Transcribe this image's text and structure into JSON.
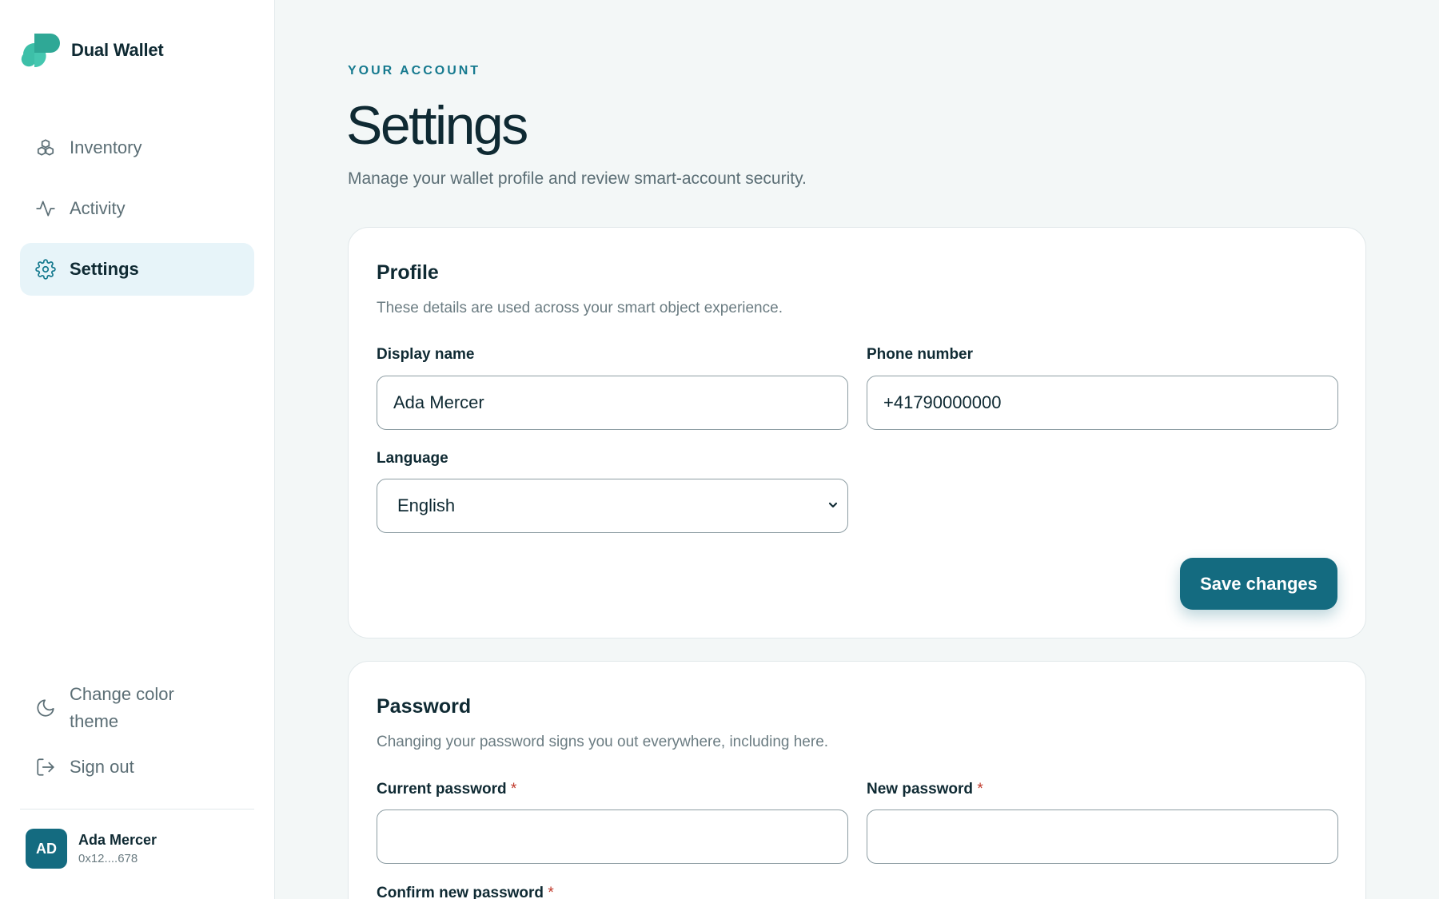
{
  "app": {
    "name": "Dual Wallet"
  },
  "sidebar": {
    "nav": [
      {
        "label": "Inventory",
        "icon": "boxes-icon"
      },
      {
        "label": "Activity",
        "icon": "activity-icon"
      },
      {
        "label": "Settings",
        "icon": "gear-icon",
        "active": true
      }
    ],
    "theme_label": "Change color theme",
    "signout_label": "Sign out",
    "user": {
      "initials": "AD",
      "name": "Ada Mercer",
      "address": "0x12....678"
    }
  },
  "header": {
    "eyebrow": "YOUR ACCOUNT",
    "title": "Settings",
    "subtitle": "Manage your wallet profile and review smart-account security."
  },
  "profile": {
    "title": "Profile",
    "subtitle": "These details are used across your smart object experience.",
    "display_name": {
      "label": "Display name",
      "value": "Ada Mercer"
    },
    "phone": {
      "label": "Phone number",
      "value": "+41790000000"
    },
    "language": {
      "label": "Language",
      "value": "English"
    },
    "save_label": "Save changes"
  },
  "password": {
    "title": "Password",
    "subtitle": "Changing your password signs you out everywhere, including here.",
    "current": {
      "label": "Current password",
      "value": ""
    },
    "new": {
      "label": "New password",
      "value": ""
    },
    "confirm": {
      "label": "Confirm new password"
    },
    "required_mark": "*"
  },
  "colors": {
    "accent": "#146b80",
    "accent_light": "#e7f4f9",
    "logo_teal": "#3dbfa8"
  }
}
